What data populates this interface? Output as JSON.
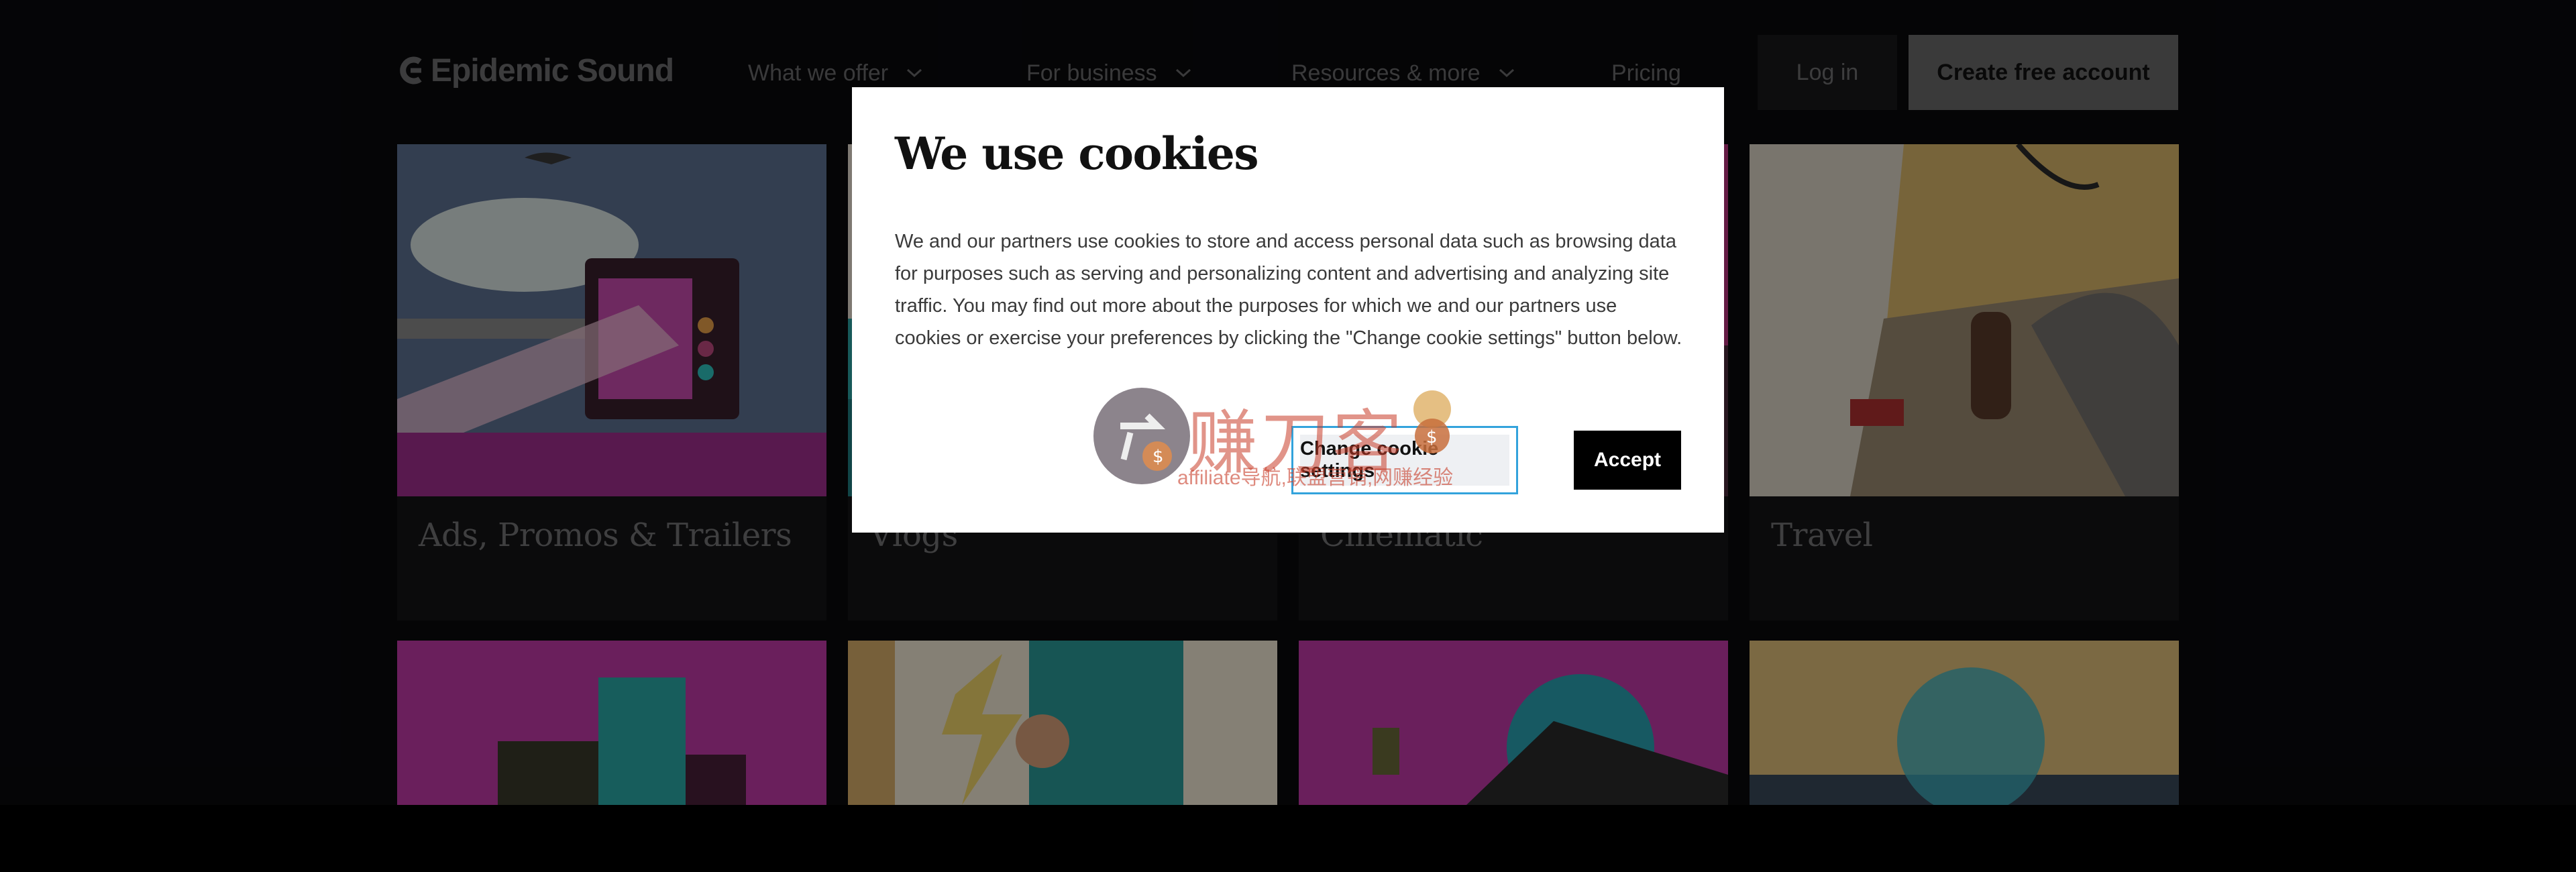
{
  "header": {
    "logo_text": "Epidemic Sound",
    "nav": [
      {
        "label": "What we offer",
        "has_dropdown": true
      },
      {
        "label": "For business",
        "has_dropdown": true
      },
      {
        "label": "Resources & more",
        "has_dropdown": true
      },
      {
        "label": "Pricing",
        "has_dropdown": false
      }
    ],
    "login_label": "Log in",
    "create_account_label": "Create free account"
  },
  "cards": {
    "row1": [
      {
        "title": "Ads, Promos & Trailers"
      },
      {
        "title": "Vlogs"
      },
      {
        "title": "Cinematic"
      },
      {
        "title": "Travel"
      }
    ]
  },
  "cookie_dialog": {
    "title": "We use cookies",
    "body": "We and our partners use cookies to store and access personal data such as browsing data for purposes such as serving and personalizing content and advertising and analyzing site traffic. You may find out more about the purposes for which we and our partners use cookies or exercise your preferences by clicking the \"Change cookie settings\" button below.",
    "change_settings_label": "Change cookie settings",
    "accept_label": "Accept"
  },
  "watermark": {
    "text": "赚刀客",
    "subtext": "affiliate导航,联盟营销,网赚经验"
  },
  "colors": {
    "page_bg": "#0a0a0c",
    "overlay": "rgba(0,0,0,0.45)",
    "accept_bg": "#000000",
    "focus_ring": "#33a3dc",
    "card_magenta": "#c23aa8",
    "card_teal": "#2aa9a8",
    "card_sand": "#e0c07a"
  }
}
